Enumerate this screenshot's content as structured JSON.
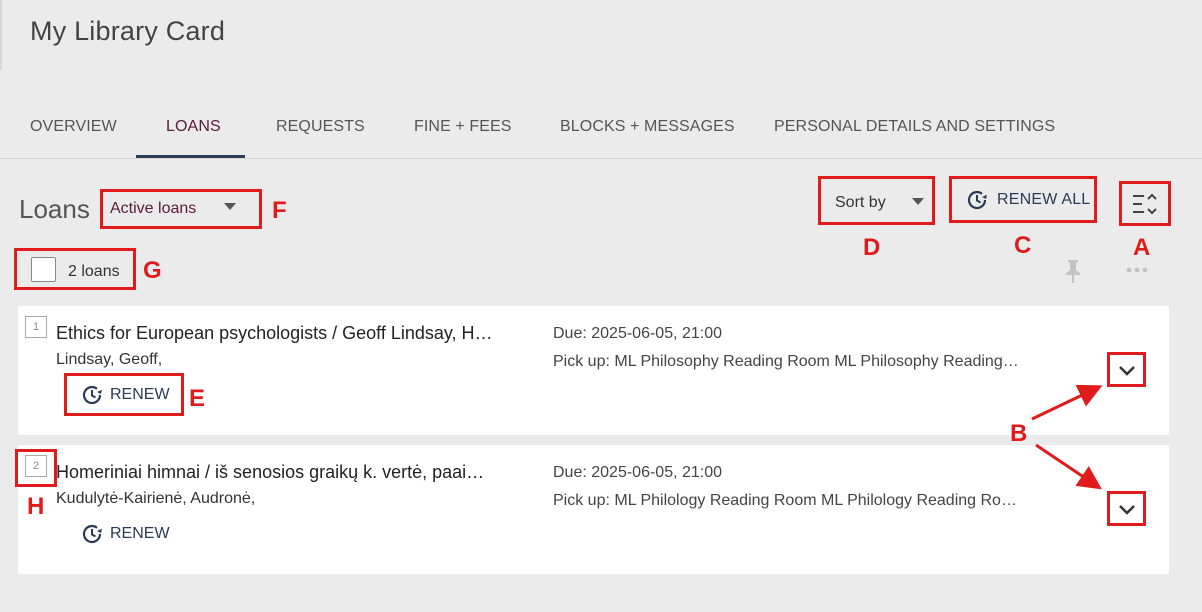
{
  "page_title": "My Library Card",
  "tabs": [
    {
      "label": "OVERVIEW"
    },
    {
      "label": "LOANS"
    },
    {
      "label": "REQUESTS"
    },
    {
      "label": "FINE + FEES"
    },
    {
      "label": "BLOCKS + MESSAGES"
    },
    {
      "label": "PERSONAL DETAILS AND SETTINGS"
    }
  ],
  "active_tab": "LOANS",
  "loans_section": {
    "heading": "Loans",
    "filter_value": "Active loans",
    "sort_label": "Sort by",
    "renew_all_label": "RENEW ALL",
    "count_label": "2 loans"
  },
  "loans": [
    {
      "index": "1",
      "title": "Ethics for European psychologists / Geoff Lindsay, H…",
      "author": "Lindsay, Geoff,",
      "due": "Due: 2025-06-05, 21:00",
      "pickup": "Pick up: ML Philosophy Reading Room ML Philosophy Reading…",
      "renew_label": "RENEW"
    },
    {
      "index": "2",
      "title": "Homeriniai himnai / iš senosios graikų k. vertė, paai…",
      "author": "Kudulytė-Kairienė, Audronė,",
      "due": "Due: 2025-06-05, 21:00",
      "pickup": "Pick up: ML Philology Reading Room ML Philology Reading Ro…",
      "renew_label": "RENEW"
    }
  ],
  "annotations": {
    "A": "A",
    "B": "B",
    "C": "C",
    "D": "D",
    "E": "E",
    "F": "F",
    "G": "G",
    "H": "H"
  },
  "colors": {
    "accent": "#5a1a3a",
    "button_text": "#2b3a55",
    "annotation": "#e01b1b",
    "background": "#ebebeb"
  }
}
